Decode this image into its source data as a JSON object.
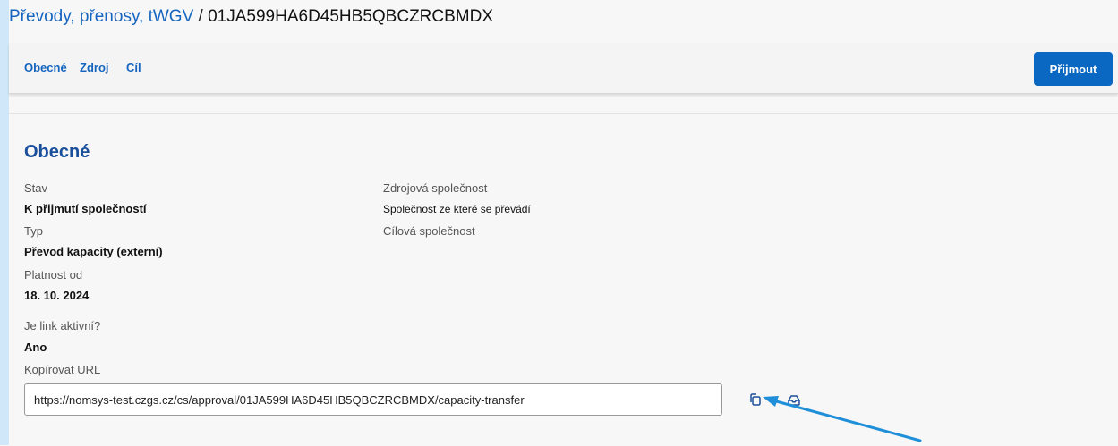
{
  "header": {
    "breadcrumb": "Převody, přenosy, tWGV",
    "separator": " / ",
    "record_id": "01JA599HA6D45HB5QBCZRCBMDX"
  },
  "tabs": [
    "Obecné",
    "Zdroj",
    "Cíl"
  ],
  "actions": {
    "accept_label": "Přijmout"
  },
  "general": {
    "section_title": "Obecné",
    "status_label": "Stav",
    "status_value": "K přijmutí společností",
    "type_label": "Typ",
    "type_value": "Převod kapacity (externí)",
    "valid_from_label": "Platnost od",
    "valid_from_value": "18. 10. 2024",
    "link_active_label": "Je link aktivní?",
    "link_active_value": "Ano",
    "source_company_label": "Zdrojová společnost",
    "source_company_value": "Společnost ze které se převádí",
    "target_company_label": "Cílová společnost",
    "copy_url_label": "Kopírovat URL",
    "url_value": "https://nomsys-test.czgs.cz/cs/approval/01JA599HA6D45HB5QBCZRCBMDX/capacity-transfer"
  },
  "icons": {
    "copy": "copy-icon",
    "mail": "mail-icon",
    "annotation": "arrow-icon"
  },
  "colors": {
    "accent": "#1565c0",
    "button": "#0a67c2",
    "arrow": "#1e8fd8"
  }
}
